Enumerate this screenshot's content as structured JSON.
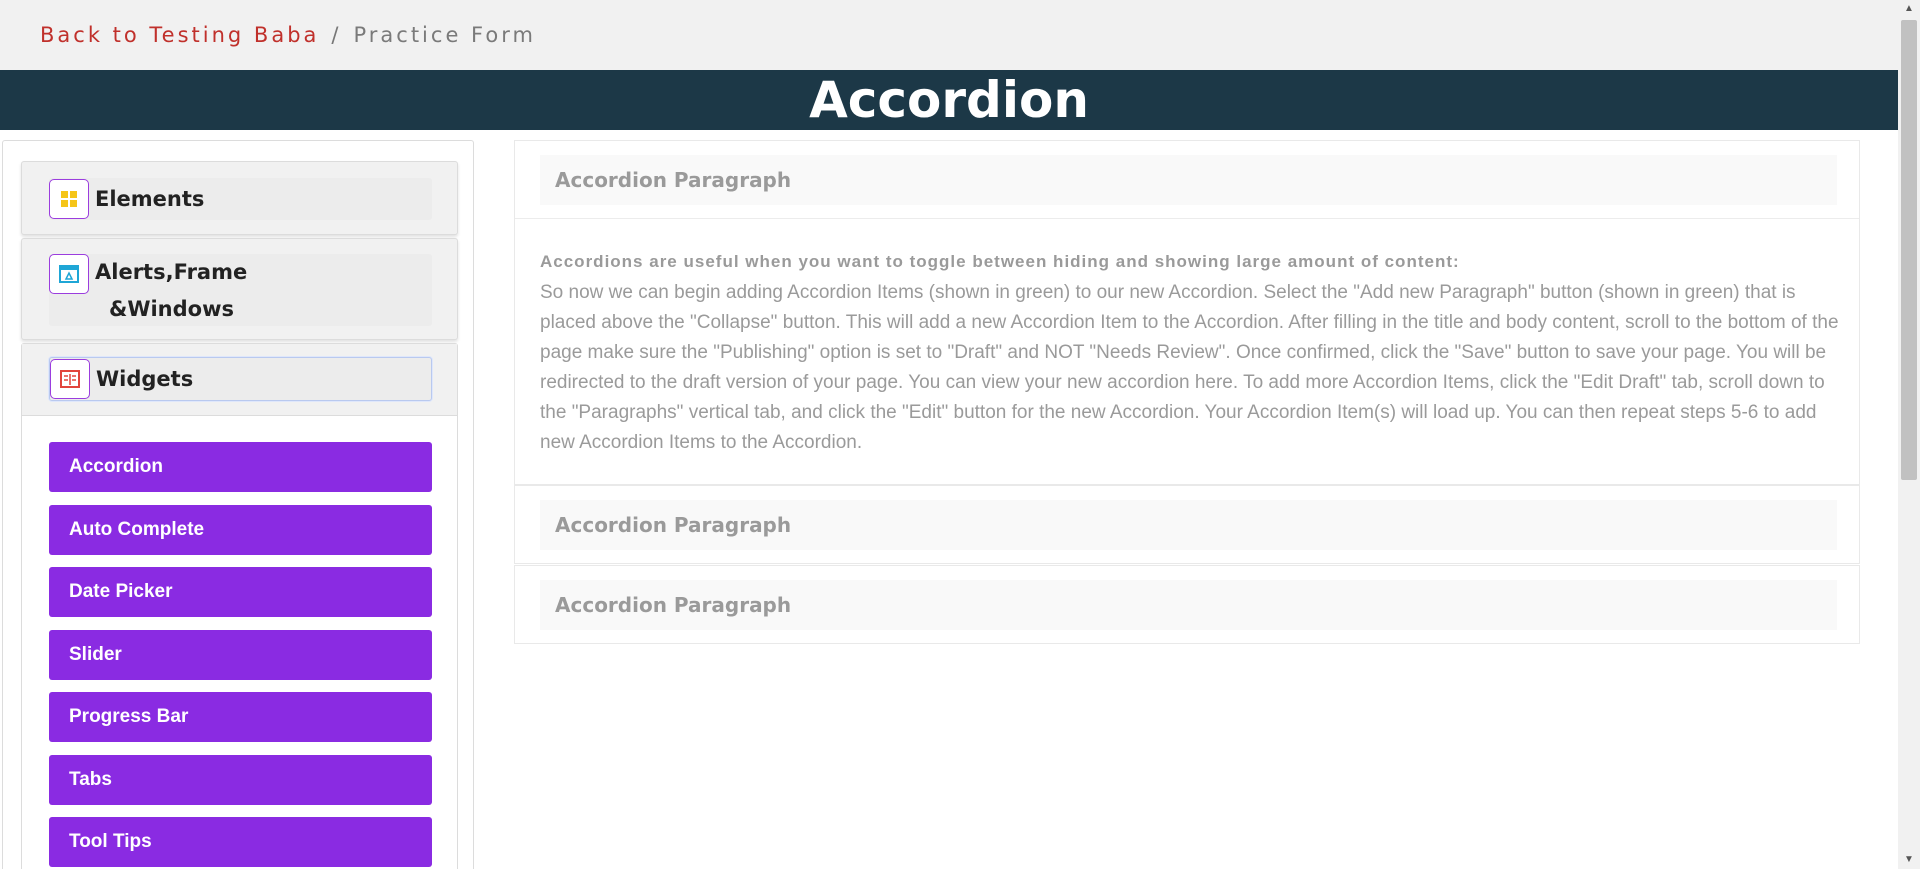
{
  "breadcrumb": {
    "back_link": "Back to Testing Baba",
    "separator": "/",
    "current": "Practice Form"
  },
  "page_title": "Accordion",
  "sidebar": {
    "groups": [
      {
        "label": "Elements",
        "icon": "elements-grid-icon"
      },
      {
        "label_line1": "Alerts,Frame",
        "label_line2": "&Windows",
        "icon": "window-icon"
      },
      {
        "label": "Widgets",
        "icon": "widgets-icon"
      }
    ],
    "widget_items": [
      "Accordion",
      "Auto Complete",
      "Date Picker",
      "Slider",
      "Progress Bar",
      "Tabs",
      "Tool Tips"
    ]
  },
  "accordion": {
    "items": [
      {
        "title": "Accordion Paragraph"
      },
      {
        "title": "Accordion Paragraph"
      },
      {
        "title": "Accordion Paragraph"
      }
    ],
    "body_title": "Accordions are useful when you want to toggle between hiding and showing large amount of content:",
    "body_text": "So now we can begin adding Accordion Items (shown in green) to our new Accordion. Select the \"Add new Paragraph\" button (shown in green) that is placed above the \"Collapse\" button. This will add a new Accordion Item to the Accordion. After filling in the title and body content, scroll to the bottom of the page make sure the \"Publishing\" option is set to \"Draft\" and NOT \"Needs Review\". Once confirmed, click the \"Save\" button to save your page. You will be redirected to the draft version of your page. You can view your new accordion here. To add more Accordion Items, click the \"Edit Draft\" tab, scroll down to the \"Paragraphs\" vertical tab, and click the \"Edit\" button for the new Accordion. Your Accordion Item(s) will load up. You can then repeat steps 5-6 to add new Accordion Items to the Accordion."
  },
  "colors": {
    "title_bar": "#1c3847",
    "menu_item": "#8a2be2",
    "back_link": "#c0302b"
  }
}
